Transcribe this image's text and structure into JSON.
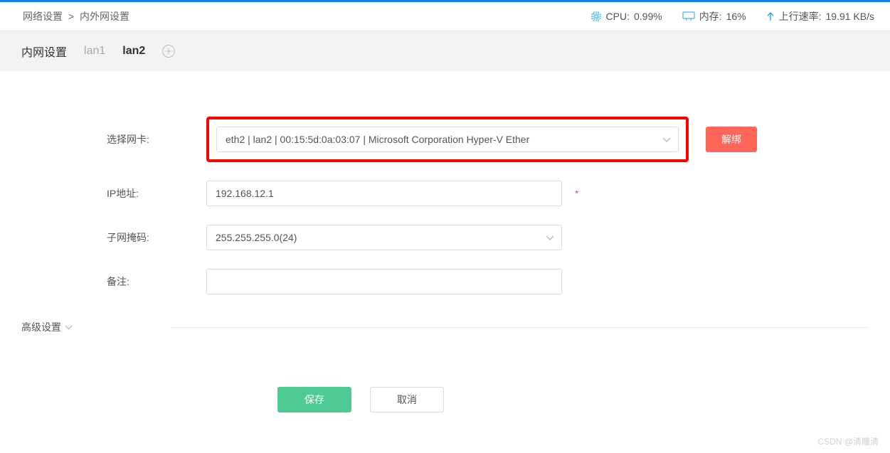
{
  "breadcrumb": {
    "part1": "网络设置",
    "sep": ">",
    "part2": "内外网设置"
  },
  "status": {
    "cpu_label": "CPU:",
    "cpu_value": "0.99%",
    "mem_label": "内存:",
    "mem_value": "16%",
    "up_label": "上行速率:",
    "up_value": "19.91 KB/s"
  },
  "tabs": {
    "title": "内网设置",
    "items": [
      {
        "label": "lan1",
        "active": false
      },
      {
        "label": "lan2",
        "active": true
      }
    ]
  },
  "form": {
    "nic_label": "选择网卡:",
    "nic_value": "eth2 | lan2 | 00:15:5d:0a:03:07 | Microsoft Corporation Hyper-V Ether",
    "ip_label": "IP地址:",
    "ip_value": "192.168.12.1",
    "mask_label": "子网掩码:",
    "mask_value": "255.255.255.0(24)",
    "note_label": "备注:",
    "note_value": ""
  },
  "buttons": {
    "unbind": "解绑",
    "save": "保存",
    "cancel": "取消"
  },
  "advanced_label": "高级设置",
  "required_mark": "*",
  "watermark": "CSDN @清瞳清"
}
